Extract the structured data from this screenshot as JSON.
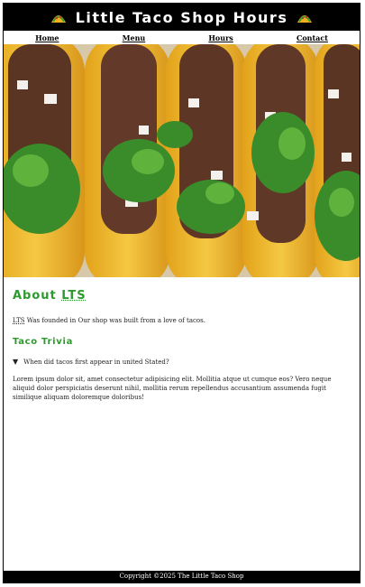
{
  "header": {
    "title": "Little Taco Shop Hours",
    "left_icon": "taco-icon",
    "right_icon": "taco-icon"
  },
  "nav": {
    "items": [
      "Home",
      "Menu",
      "Hours",
      "Contact"
    ]
  },
  "hero": {
    "image": "tacos-photo"
  },
  "about": {
    "heading_prefix": "About ",
    "heading_abbr": "LTS",
    "text_abbr": "LTS",
    "text_rest": " Was founded in Our shop was built from a love of tacos."
  },
  "trivia": {
    "heading": "Taco Trivia",
    "question": "When did tacos first appear in united Stated?",
    "answer": "Lorem ipsum dolor sit, amet consectetur adipisicing elit. Mollitia atque ut cumque eos? Vero neque aliquid dolor perspiciatis deserunt nihil, mollitia rerum repellendus accusantium assumenda fugit similique aliquam doloremque doloribus!"
  },
  "footer": {
    "text": "Copyright ©2025 The Little Taco Shop"
  },
  "colors": {
    "accent_green": "#2e9a2e",
    "header_bg": "#000000"
  }
}
